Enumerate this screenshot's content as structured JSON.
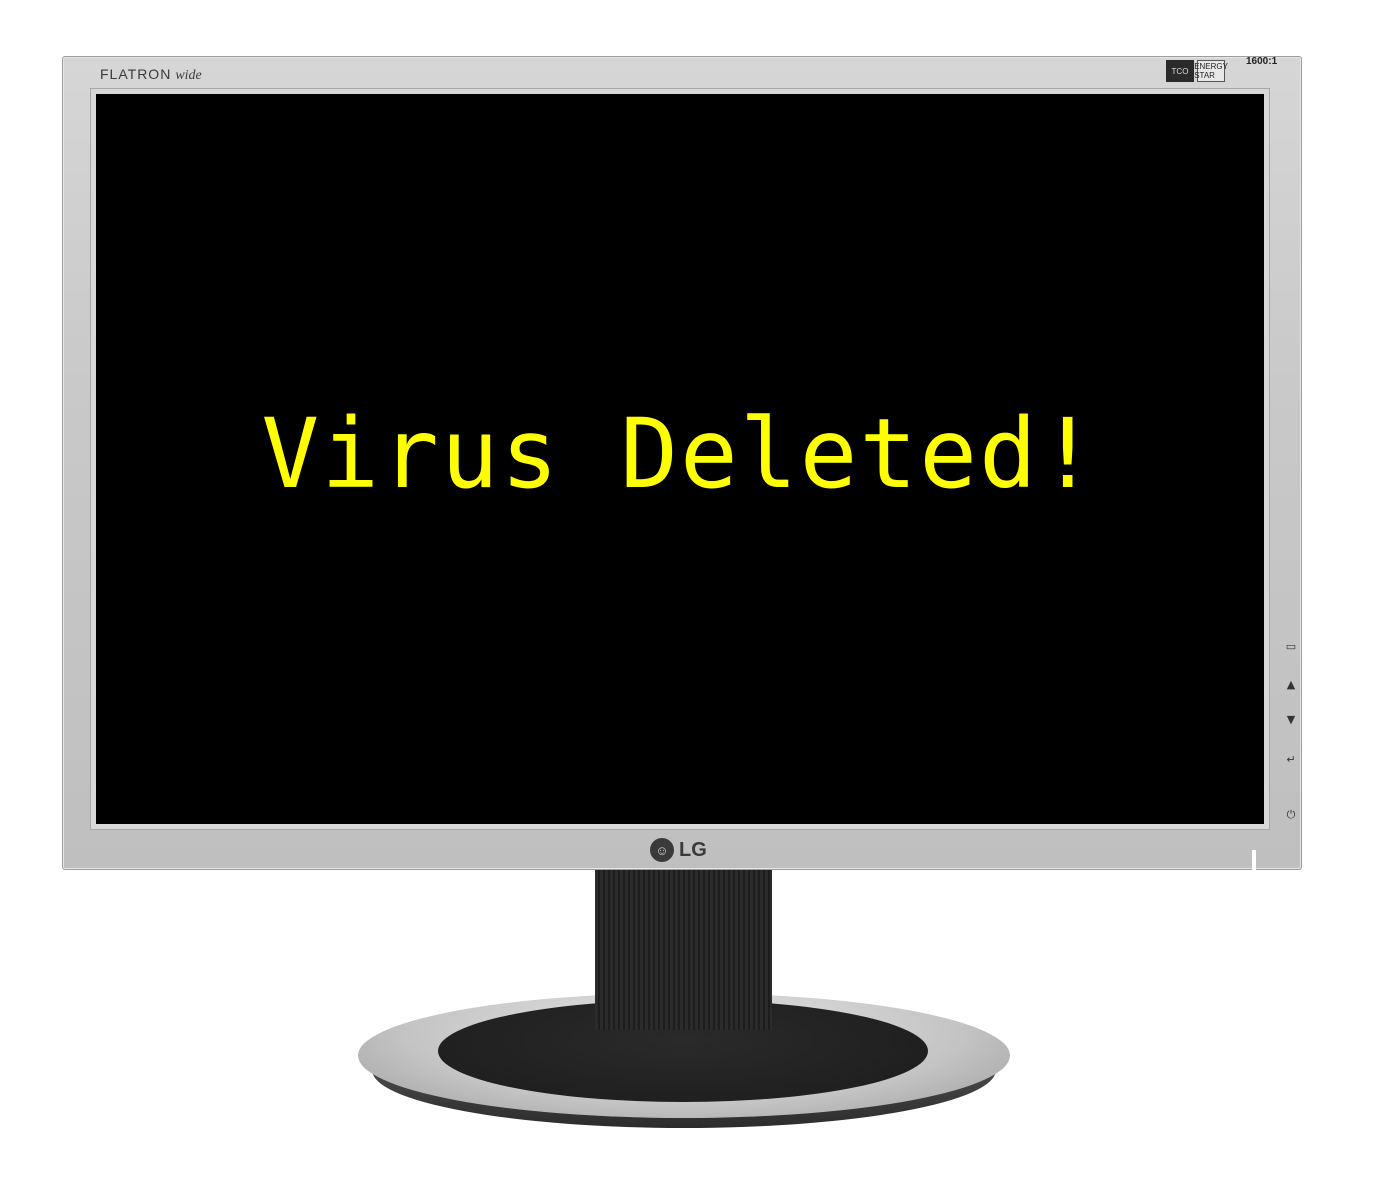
{
  "screen": {
    "message": "Virus Deleted!"
  },
  "bezel": {
    "model": "FLATRON",
    "model_suffix": "wide",
    "brand": "LG",
    "certifications": [
      "TCO",
      "ENERGY STAR"
    ],
    "contrast_badge": "1600:1"
  },
  "controls": [
    {
      "name": "menu",
      "icon": "menu-icon",
      "glyph": "▭"
    },
    {
      "name": "up",
      "icon": "arrow-up-icon",
      "glyph": "▲"
    },
    {
      "name": "down",
      "icon": "arrow-down-icon",
      "glyph": "▼"
    },
    {
      "name": "enter",
      "icon": "enter-icon",
      "glyph": "↵"
    },
    {
      "name": "power",
      "icon": "power-icon",
      "glyph": "⏻"
    }
  ],
  "colors": {
    "message": "#ffff00",
    "screen": "#000000",
    "bezel": "#c9c9c9"
  }
}
